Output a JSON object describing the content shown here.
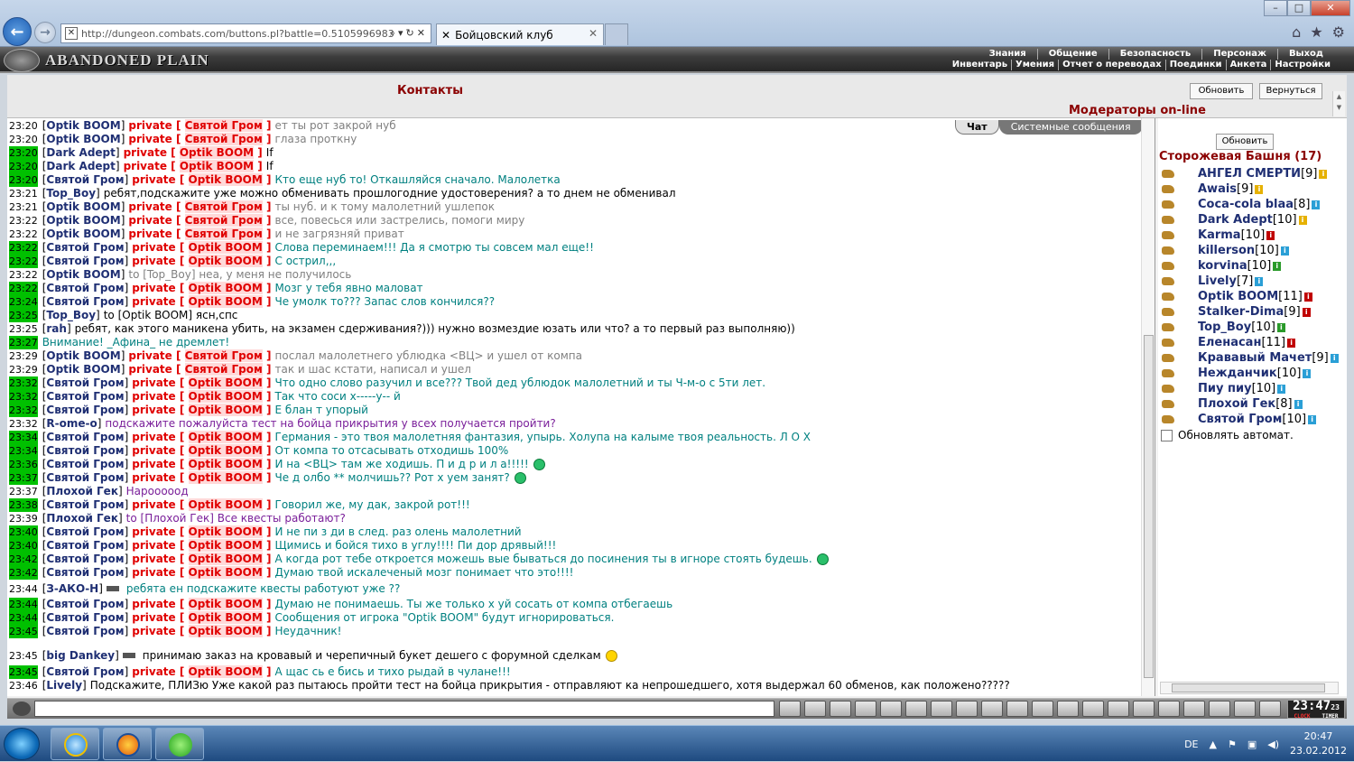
{
  "browser": {
    "url": "http://dungeon.combats.com/buttons.pl?battle=0.5105996983",
    "tab_title": "Бойцовский клуб"
  },
  "game": {
    "logo": "ABANDONED PLAIN",
    "menu_row1": [
      "Знания",
      "Общение",
      "Безопасность",
      "Персонаж",
      "Выход"
    ],
    "menu_row2": [
      "Инвентарь",
      "Умения",
      "Отчет о переводах",
      "Поединки",
      "Анкета",
      "Настройки"
    ]
  },
  "contacts": {
    "title": "Контакты",
    "refresh": "Обновить",
    "return": "Вернуться",
    "moderators_title": "Модераторы on-line"
  },
  "chat_tabs": {
    "chat": "Чат",
    "system": "Системные сообщения"
  },
  "messages": [
    {
      "time": "23:20",
      "hl": false,
      "nick": "Optik BOOM",
      "prv": "Святой Гром",
      "text": "ет ты рот закрой нуб",
      "cls": "gray"
    },
    {
      "time": "23:20",
      "hl": false,
      "nick": "Optik BOOM",
      "prv": "Святой Гром",
      "text": "глаза проткну",
      "cls": "gray"
    },
    {
      "time": "23:20",
      "hl": true,
      "nick": "Dark Adept",
      "prv": "Optik BOOM",
      "text": "If",
      "cls": "black"
    },
    {
      "time": "23:20",
      "hl": true,
      "nick": "Dark Adept",
      "prv": "Optik BOOM",
      "text": "If",
      "cls": "black"
    },
    {
      "time": "23:20",
      "hl": true,
      "nick": "Святой Гром",
      "prv": "Optik BOOM",
      "text": "Кто еще нуб то! Откашляйся сначало. Малолетка",
      "cls": "teal"
    },
    {
      "time": "23:21",
      "hl": false,
      "nick": "Top_Boy",
      "prv": "",
      "text": "ребят,подскажите уже можно обменивать прошлогодние удостоверения? а то днем не обменивал",
      "cls": "black"
    },
    {
      "time": "23:21",
      "hl": false,
      "nick": "Optik BOOM",
      "prv": "Святой Гром",
      "text": "ты нуб. и к тому малолетний ушлепок",
      "cls": "gray"
    },
    {
      "time": "23:22",
      "hl": false,
      "nick": "Optik BOOM",
      "prv": "Святой Гром",
      "text": "все, повесься или застрелись, помоги миру",
      "cls": "gray"
    },
    {
      "time": "23:22",
      "hl": false,
      "nick": "Optik BOOM",
      "prv": "Святой Гром",
      "text": "и не загрязняй приват",
      "cls": "gray"
    },
    {
      "time": "23:22",
      "hl": true,
      "nick": "Святой Гром",
      "prv": "Optik BOOM",
      "text": "Слова перeминаем!!! Да я смотрю ты совсем мал еще!!",
      "cls": "teal"
    },
    {
      "time": "23:22",
      "hl": true,
      "nick": "Святой Гром",
      "prv": "Optik BOOM",
      "text": "С острил,,,",
      "cls": "teal"
    },
    {
      "time": "23:22",
      "hl": false,
      "nick": "Optik BOOM",
      "prv": "",
      "text": "to [Top_Boy] неа, у меня не получилось",
      "cls": "gray"
    },
    {
      "time": "23:22",
      "hl": true,
      "nick": "Святой Гром",
      "prv": "Optik BOOM",
      "text": "Мозг у тебя явно маловат",
      "cls": "teal"
    },
    {
      "time": "23:24",
      "hl": true,
      "nick": "Святой Гром",
      "prv": "Optik BOOM",
      "text": "Че умолк то??? Запас слов кончился??",
      "cls": "teal"
    },
    {
      "time": "23:25",
      "hl": true,
      "nick": "Top_Boy",
      "prv": "",
      "text": "to [Optik BOOM] ясн,спс",
      "cls": "black"
    },
    {
      "time": "23:25",
      "hl": false,
      "nick": "rah",
      "prv": "",
      "text": "ребят, как этого маникена убить, на экзамен сдерживания?))) нужно возмездие юзать или что? а то первый раз выполняю))",
      "cls": "black"
    },
    {
      "time": "23:27",
      "hl": true,
      "nick": "",
      "prv": "",
      "text": "Внимание! _Афина_ не дремлет!",
      "cls": "warn"
    },
    {
      "time": "23:29",
      "hl": false,
      "nick": "Optik BOOM",
      "prv": "Святой Гром",
      "text": "послал малолетнего ублюдка <ВЦ> и ушел от компа",
      "cls": "gray"
    },
    {
      "time": "23:29",
      "hl": false,
      "nick": "Optik BOOM",
      "prv": "Святой Гром",
      "text": "так и шас кстати, написал и ушел",
      "cls": "gray"
    },
    {
      "time": "23:32",
      "hl": true,
      "nick": "Святой Гром",
      "prv": "Optik BOOM",
      "text": "Что одно слово разучил и все??? Твой дед ублюдок малолетний и ты Ч-м-о с 5ти лет.",
      "cls": "teal"
    },
    {
      "time": "23:32",
      "hl": true,
      "nick": "Святой Гром",
      "prv": "Optik BOOM",
      "text": "Так что соси х-----у-- й",
      "cls": "teal"
    },
    {
      "time": "23:32",
      "hl": true,
      "nick": "Святой Гром",
      "prv": "Optik BOOM",
      "text": "Е блан т упорый",
      "cls": "teal"
    },
    {
      "time": "23:32",
      "hl": false,
      "nick": "R-ome-o",
      "prv": "",
      "text": "подскажите пожалуйста тест на бойца прикрытия у всех получается пройти?",
      "cls": "purple"
    },
    {
      "time": "23:34",
      "hl": true,
      "nick": "Святой Гром",
      "prv": "Optik BOOM",
      "text": "Германия - это твоя малолетняя фантазия, упырь. Холупа на калыме твоя реальность. Л О Х",
      "cls": "teal"
    },
    {
      "time": "23:34",
      "hl": true,
      "nick": "Святой Гром",
      "prv": "Optik BOOM",
      "text": "От компа то отсасывать отходишь 100%",
      "cls": "teal"
    },
    {
      "time": "23:36",
      "hl": true,
      "nick": "Святой Гром",
      "prv": "Optik BOOM",
      "text": "И на <ВЦ> там же ходишь. П и д р и л а!!!!!",
      "cls": "teal",
      "smile": true
    },
    {
      "time": "23:37",
      "hl": true,
      "nick": "Святой Гром",
      "prv": "Optik BOOM",
      "text": "Че д олбо ** молчишь?? Рот х уем занят?",
      "cls": "teal",
      "smile": true
    },
    {
      "time": "23:37",
      "hl": false,
      "nick": "Плохой Гек",
      "prv": "",
      "text": "Нарооооод",
      "cls": "purple"
    },
    {
      "time": "23:38",
      "hl": true,
      "nick": "Святой Гром",
      "prv": "Optik BOOM",
      "text": "Говорил же, му дак, закрой рот!!!",
      "cls": "teal"
    },
    {
      "time": "23:39",
      "hl": false,
      "nick": "Плохой Гек",
      "prv": "",
      "text": "to [Плохой Гек] Все квесты работают?",
      "cls": "purple"
    },
    {
      "time": "23:40",
      "hl": true,
      "nick": "Святой Гром",
      "prv": "Optik BOOM",
      "text": "И не пи з ди в след. раз олень малолетний",
      "cls": "teal"
    },
    {
      "time": "23:40",
      "hl": true,
      "nick": "Святой Гром",
      "prv": "Optik BOOM",
      "text": "Щимись и бойся тихо в углу!!!! Пи дор дрявый!!!",
      "cls": "teal"
    },
    {
      "time": "23:42",
      "hl": true,
      "nick": "Святой Гром",
      "prv": "Optik BOOM",
      "text": "А когда рот тебе откроется можешь вые бываться до посинения ты в игноре стоять будешь.",
      "cls": "teal",
      "smile": true
    },
    {
      "time": "23:42",
      "hl": true,
      "nick": "Святой Гром",
      "prv": "Optik BOOM",
      "text": "Думаю твой искалеченый мозг понимает что это!!!!",
      "cls": "teal"
    },
    {
      "time": "23:44",
      "hl": false,
      "nick": "З-АКО-Н",
      "prv": "",
      "text": "ребята ен подскажите квесты работуют уже ??",
      "cls": "teal",
      "gun": true
    },
    {
      "time": "23:44",
      "hl": true,
      "nick": "Святой Гром",
      "prv": "Optik BOOM",
      "text": "Думаю не понимаешь. Ты же только х уй сосать от компа отбегаешь",
      "cls": "teal"
    },
    {
      "time": "23:44",
      "hl": true,
      "nick": "Святой Гром",
      "prv": "Optik BOOM",
      "text": "Сообщения от игрока \"Optik BOOM\" будут игнорироваться.",
      "cls": "teal"
    },
    {
      "time": "23:45",
      "hl": true,
      "nick": "Святой Гром",
      "prv": "Optik BOOM",
      "text": "Неудачник!",
      "cls": "teal"
    },
    {
      "time": "23:45",
      "hl": false,
      "nick": "big Dankey",
      "prv": "",
      "text": "принимаю заказ на кровавый и черепичный букет дешего с форумной сделкам",
      "cls": "black",
      "gun": true,
      "smile_y": true
    },
    {
      "time": "23:45",
      "hl": true,
      "nick": "Святой Гром",
      "prv": "Optik BOOM",
      "text": "А щас сь е бись и тихо рыдай в чулане!!!",
      "cls": "teal"
    },
    {
      "time": "23:46",
      "hl": false,
      "nick": "Lively",
      "prv": "",
      "text": "Подскажите, ПЛИЗю Уже какой раз пытаюсь пройти тест на бойца прикрытия - отправляют ка непрошедшего, хотя выдержал 60 обменов, как положено?????",
      "cls": "black"
    }
  ],
  "private_label": "private",
  "side": {
    "refresh": "Обновить",
    "tower_title": "Сторожевая Башня (17)",
    "auto_refresh": "Обновлять автомат.",
    "moderators": [
      {
        "name": "АНГЕЛ СМЕРТИ",
        "level": "[9]",
        "info": "g"
      },
      {
        "name": "Awais",
        "level": "[9]",
        "info": "g"
      },
      {
        "name": "Coca-cola blaa",
        "level": "[8]",
        "info": "i"
      },
      {
        "name": "Dark Adept",
        "level": "[10]",
        "info": "g"
      },
      {
        "name": "Karma",
        "level": "[10]",
        "info": "r"
      },
      {
        "name": "killerson",
        "level": "[10]",
        "info": "i"
      },
      {
        "name": "korvina",
        "level": "[10]",
        "info": "gr"
      },
      {
        "name": "Lively",
        "level": "[7]",
        "info": "i"
      },
      {
        "name": "Optik BOOM",
        "level": "[11]",
        "info": "r"
      },
      {
        "name": "Stalker-Dima",
        "level": "[9]",
        "info": "r"
      },
      {
        "name": "Top_Boy",
        "level": "[10]",
        "info": "gr"
      },
      {
        "name": "Еленасан",
        "level": "[11]",
        "info": "r"
      },
      {
        "name": "Крававый Мачет",
        "level": "[9]",
        "info": "i"
      },
      {
        "name": "Нежданчик",
        "level": "[10]",
        "info": "i"
      },
      {
        "name": "Пиу пиу",
        "level": "[10]",
        "info": "i"
      },
      {
        "name": "Плохой Гек",
        "level": "[8]",
        "info": "i"
      },
      {
        "name": "Святой Гром",
        "level": "[10]",
        "info": "i"
      }
    ]
  },
  "clock": {
    "time": "23:47",
    "sec": "23",
    "clock_label": "CLOCK",
    "timer_label": "TIMER"
  },
  "taskbar": {
    "lang": "DE",
    "time": "20:47",
    "date": "23.02.2012"
  }
}
